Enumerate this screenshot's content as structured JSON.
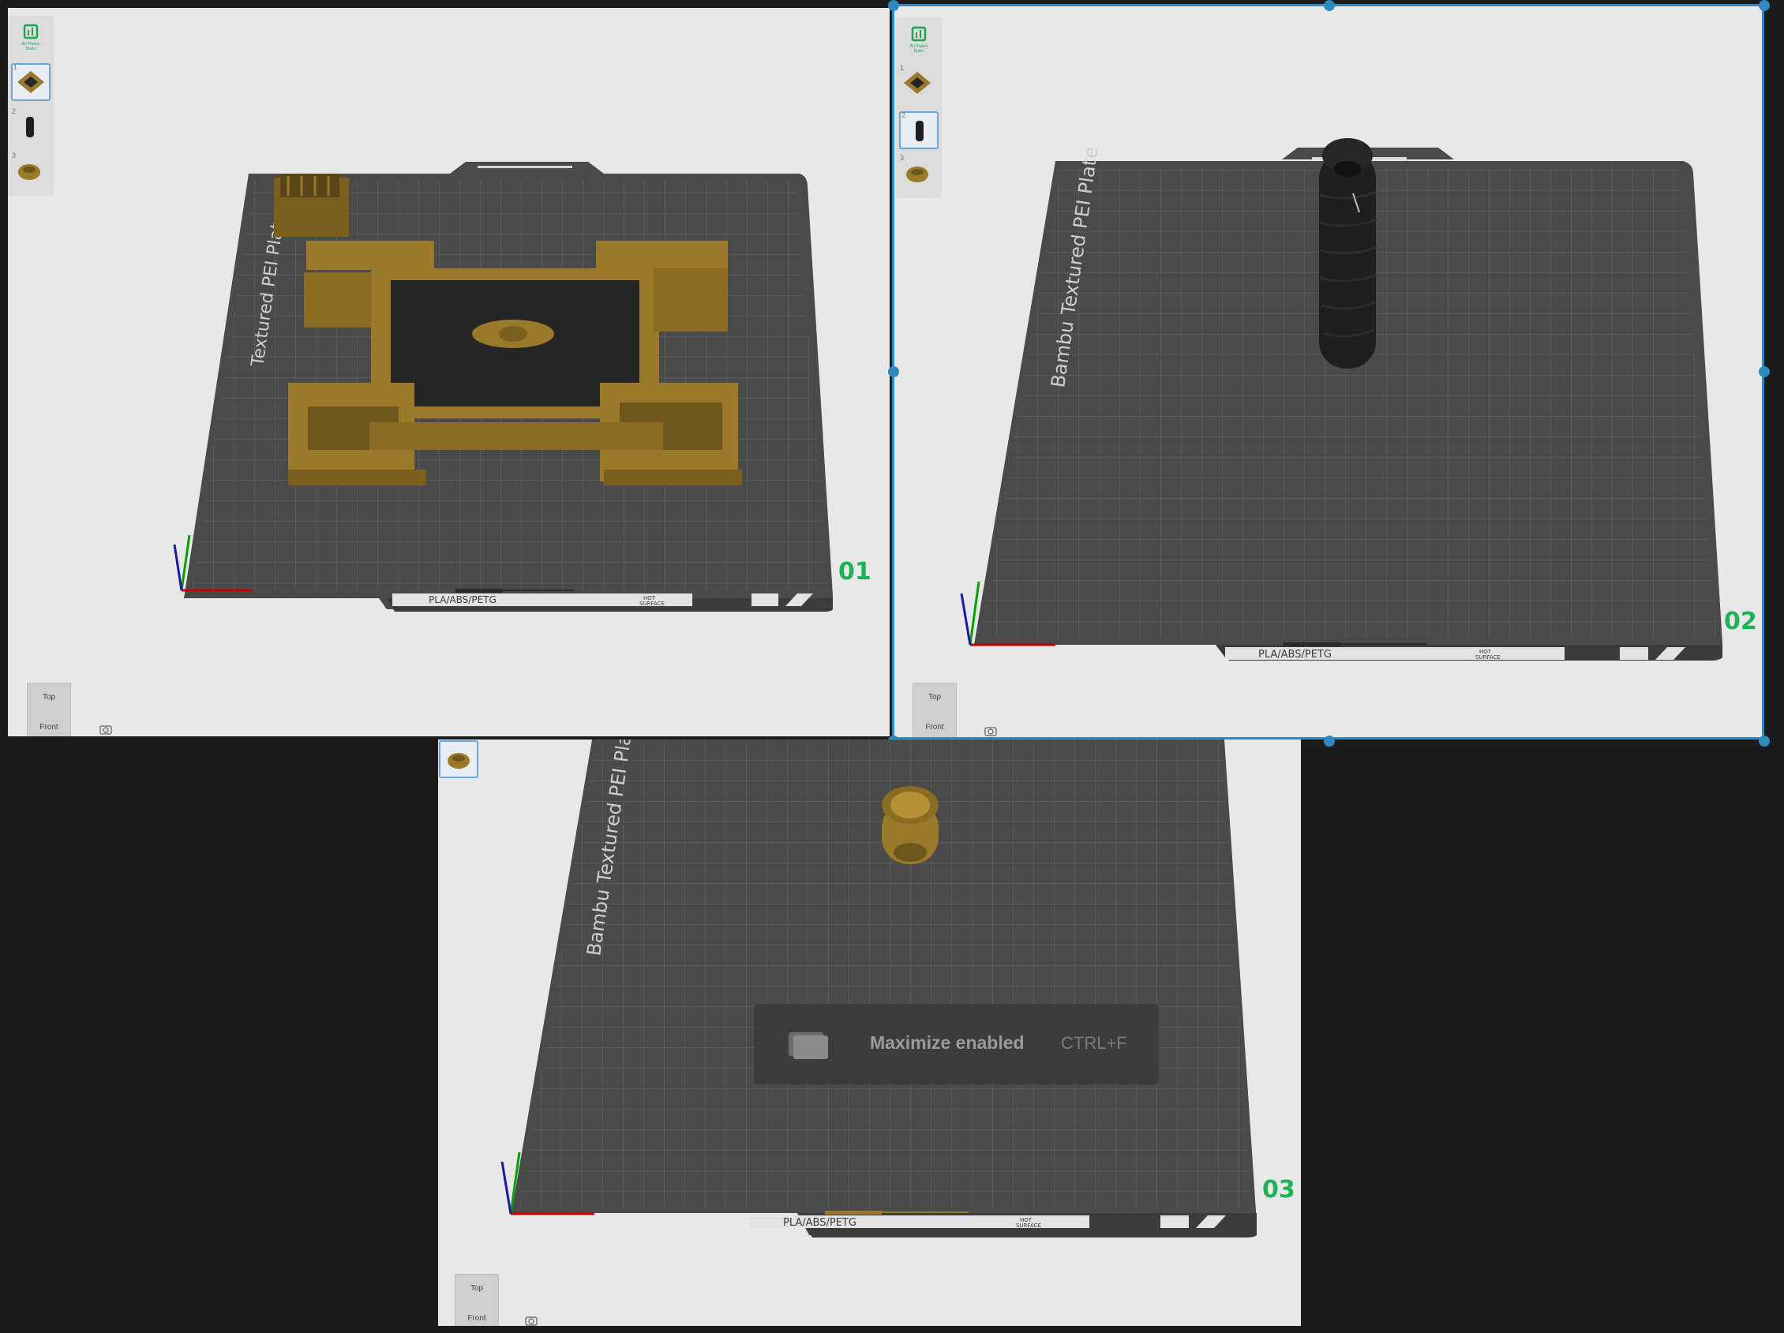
{
  "plates": [
    {
      "number": "01",
      "bed_name": "Textured PEI Plate",
      "material_label": "PLA/ABS/PETG",
      "hot_surface": [
        "HOT",
        "SURFACE"
      ],
      "thumbnail_count": 3
    },
    {
      "number": "02",
      "bed_name": "Bambu Textured PEI Plate",
      "material_label": "PLA/ABS/PETG",
      "hot_surface": [
        "HOT",
        "SURFACE"
      ],
      "thumbnail_count": 3
    },
    {
      "number": "03",
      "bed_name": "Bambu Textured PEI Plate",
      "material_label": "PLA/ABS/PETG",
      "hot_surface": [
        "HOT",
        "SURFACE"
      ],
      "thumbnail_count": 1
    }
  ],
  "sidebar": {
    "all_plates_label": "All Plates Stats",
    "items": [
      {
        "num": "1"
      },
      {
        "num": "2"
      },
      {
        "num": "3"
      }
    ]
  },
  "navcube": {
    "top": "Top",
    "front": "Front"
  },
  "toast": {
    "text": "Maximize enabled",
    "shortcut": "CTRL+F"
  },
  "colors": {
    "selection": "#2f89c0",
    "plate_number": "#1fb254",
    "model_gold": "#9a7a2a",
    "model_black": "#1f1f1f",
    "bed": "#4a4a4a",
    "background": "#1b1b1b",
    "viewport": "#e8e8e8"
  },
  "icons": [
    "stats-icon",
    "camera-icon",
    "maximize-icon"
  ]
}
